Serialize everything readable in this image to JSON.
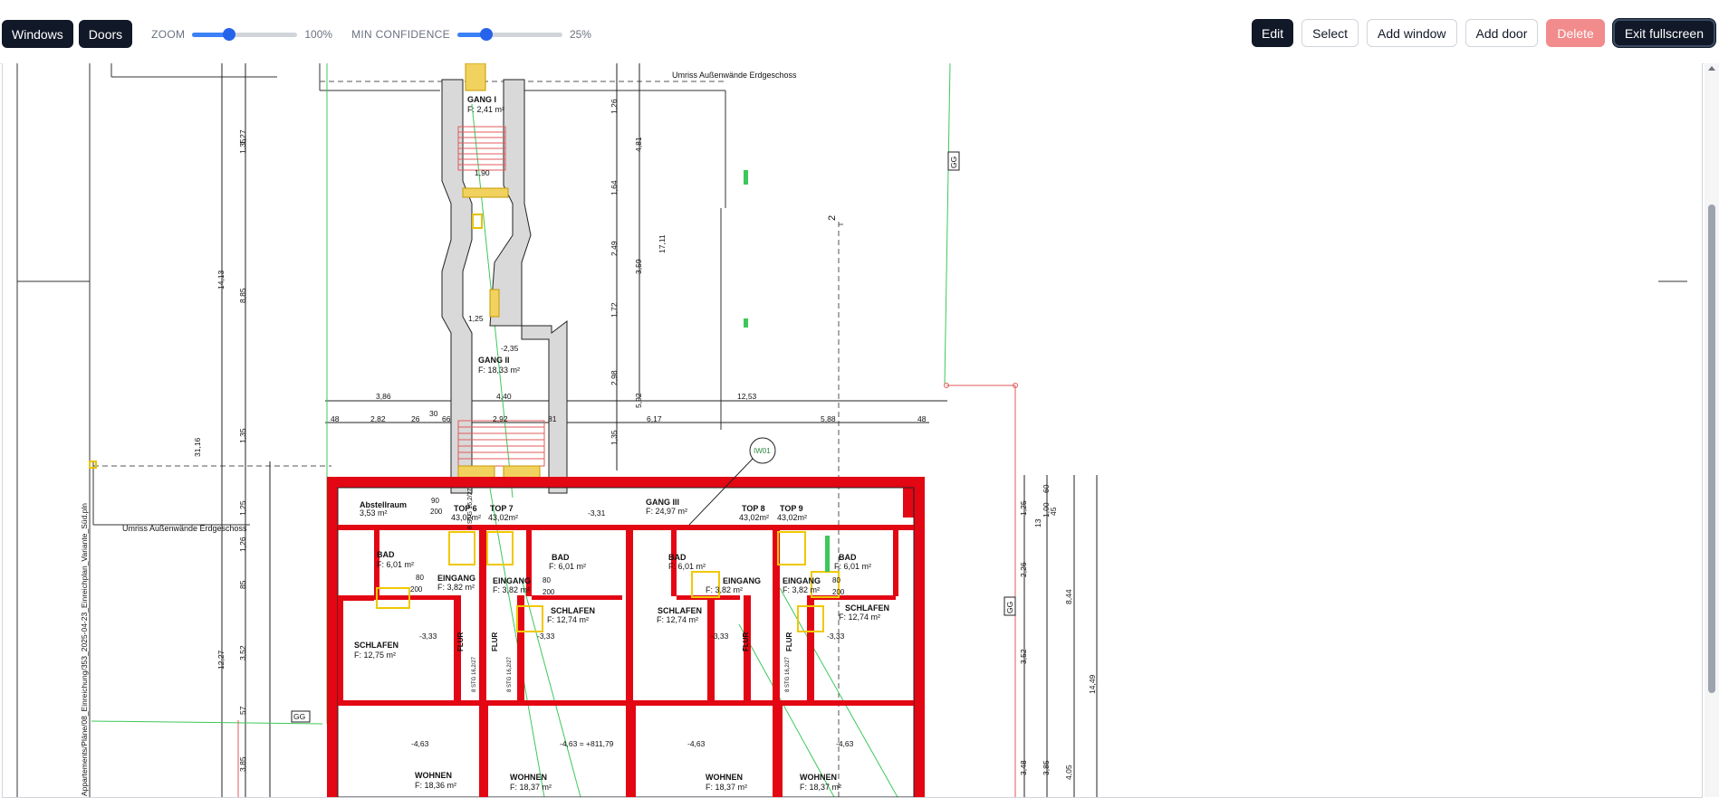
{
  "toolbar": {
    "windows_label": "Windows",
    "doors_label": "Doors",
    "zoom_label": "ZOOM",
    "zoom_value": "100%",
    "zoom_fraction": 0.35,
    "min_confidence_label": "MIN CONFIDENCE",
    "min_confidence_value": "25%",
    "min_confidence_fraction": 0.28,
    "edit_label": "Edit",
    "select_label": "Select",
    "add_window_label": "Add window",
    "add_door_label": "Add door",
    "delete_label": "Delete",
    "exit_fullscreen_label": "Exit fullscreen"
  },
  "colors": {
    "accent": "#111827",
    "slider": "#2563eb",
    "danger": "#f28b8b",
    "wall_red": "#e30613",
    "door_yellow": "#f5d200",
    "detection_green": "#22c55e"
  },
  "plan": {
    "outline_label_top": "Umriss Außenwände Erdgeschoss",
    "outline_label_left": "Umriss Außenwände Erdgeschoss",
    "file_path": "Appartements/Pläne/08_Einreichung/353_2025-04-23_Einreichplan_Variante_Süd.pln",
    "gg_label": "GG",
    "axis_marker": "2",
    "iw_label": "IW01",
    "rooms": [
      {
        "name": "GANG I",
        "area": "F: 2,41 m²"
      },
      {
        "name": "GANG II",
        "area": "F: 18,33 m²"
      },
      {
        "name": "GANG III",
        "area": "F: 24,97 m²"
      },
      {
        "name": "Abstellraum",
        "area": "3,53 m²"
      },
      {
        "name": "TOP 6",
        "area": "43,02m²"
      },
      {
        "name": "TOP 7",
        "area": "43,02m²"
      },
      {
        "name": "TOP 8",
        "area": "43,02m²"
      },
      {
        "name": "TOP 9",
        "area": "43,02m²"
      },
      {
        "name": "BAD",
        "area": "F: 6,01 m²"
      },
      {
        "name": "EINGANG",
        "area": "F: 3,82 m²"
      },
      {
        "name": "SCHLAFEN",
        "area": "F: 12,75 m²"
      },
      {
        "name": "SCHLAFEN",
        "area": "F: 12,74 m²"
      },
      {
        "name": "FLUR",
        "area": "F: 2,08 m²"
      },
      {
        "name": "WOHNEN",
        "area": "F: 18,36 m²"
      },
      {
        "name": "WOHNEN",
        "area": "F: 18,37 m²"
      }
    ],
    "levels": [
      "-2,35",
      "-3,31",
      "-3,33",
      "-4,63",
      "-4,63 = +811,79"
    ],
    "dims_top": [
      "3,86",
      "4,40",
      "12,53",
      "48",
      "2,82",
      "26",
      "30",
      "66",
      "2,92",
      "81",
      "6,17",
      "5,88",
      "48"
    ],
    "dims_left": [
      "1,27",
      "1,35",
      "14,13",
      "8,85",
      "31,16",
      "1,35",
      "1,25",
      "1,26",
      "85",
      "12,27",
      "3,52",
      "57",
      "3,85"
    ],
    "dims_mid": [
      "1,26",
      "4,81",
      "1,64",
      "2,49",
      "3,59",
      "17,11",
      "1,72",
      "2,98",
      "5,92",
      "1,35",
      "1,90",
      "1,25"
    ],
    "dims_right": [
      "1,25",
      "1,00",
      "45",
      "2,26",
      "8,44",
      "14,49",
      "3,52",
      "3,48",
      "3,85",
      "4,05",
      "60",
      "13"
    ],
    "door_dims": [
      "90",
      "200",
      "80",
      "200"
    ],
    "stair": "8 STG 16,2/27"
  }
}
